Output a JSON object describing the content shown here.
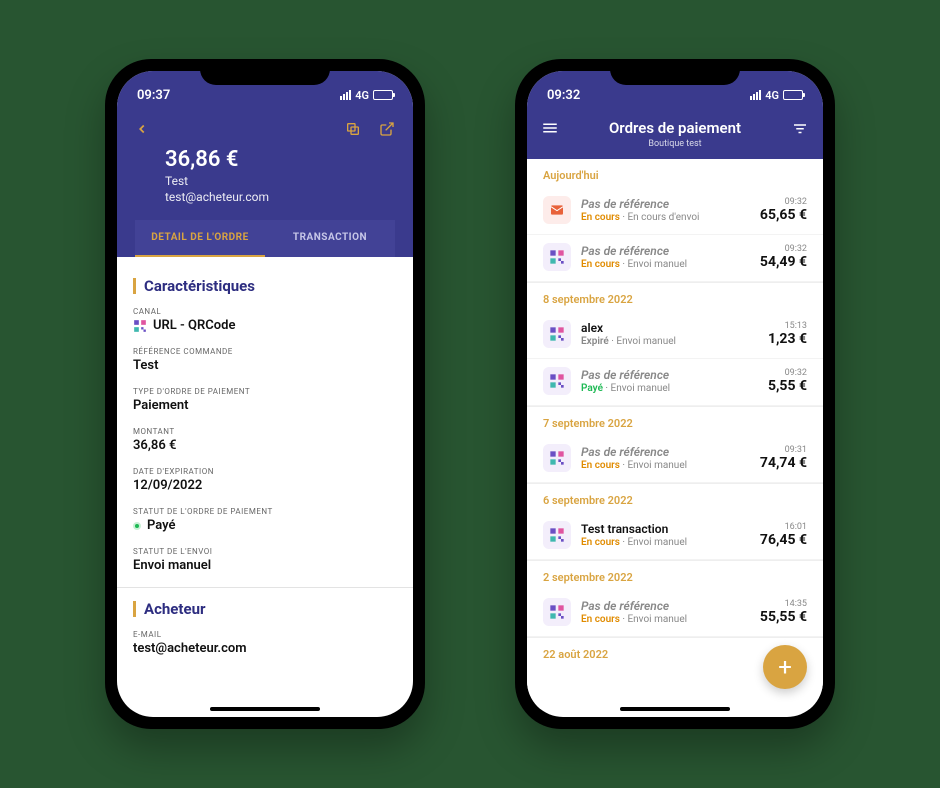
{
  "phone1": {
    "time": "09:37",
    "network": "4G",
    "header": {
      "amount": "36,86 €",
      "name": "Test",
      "email": "test@acheteur.com"
    },
    "tabs": {
      "detail": "DETAIL DE L'ORDRE",
      "transaction": "TRANSACTION"
    },
    "sections": {
      "caracteristiques": "Caractéristiques",
      "acheteur": "Acheteur"
    },
    "fields": {
      "canal": {
        "label": "CANAL",
        "value": "URL - QRCode"
      },
      "reference": {
        "label": "RÉFÉRENCE COMMANDE",
        "value": "Test"
      },
      "type": {
        "label": "TYPE D'ORDRE DE PAIEMENT",
        "value": "Paiement"
      },
      "montant": {
        "label": "MONTANT",
        "value": "36,86 €"
      },
      "expiration": {
        "label": "DATE D'EXPIRATION",
        "value": "12/09/2022"
      },
      "statut": {
        "label": "STATUT DE L'ORDRE DE PAIEMENT",
        "value": "Payé"
      },
      "envoi": {
        "label": "STATUT DE L'ENVOI",
        "value": "Envoi manuel"
      },
      "email": {
        "label": "E-MAIL",
        "value": "test@acheteur.com"
      }
    }
  },
  "phone2": {
    "time": "09:32",
    "network": "4G",
    "title": "Ordres de paiement",
    "subtitle": "Boutique test",
    "groups": [
      {
        "date": "Aujourd'hui",
        "orders": [
          {
            "icon": "mail",
            "ref": "Pas de référence",
            "noref": true,
            "status": "En cours",
            "statusClass": "en-cours",
            "method": "En cours d'envoi",
            "time": "09:32",
            "amount": "65,65 €"
          },
          {
            "icon": "qr",
            "ref": "Pas de référence",
            "noref": true,
            "status": "En cours",
            "statusClass": "en-cours",
            "method": "Envoi manuel",
            "time": "09:32",
            "amount": "54,49 €"
          }
        ]
      },
      {
        "date": "8 septembre 2022",
        "orders": [
          {
            "icon": "qr",
            "ref": "alex",
            "noref": false,
            "status": "Expiré",
            "statusClass": "expire",
            "method": "Envoi manuel",
            "time": "15:13",
            "amount": "1,23 €"
          },
          {
            "icon": "qr",
            "ref": "Pas de référence",
            "noref": true,
            "status": "Payé",
            "statusClass": "paye",
            "method": "Envoi manuel",
            "time": "09:32",
            "amount": "5,55 €"
          }
        ]
      },
      {
        "date": "7 septembre 2022",
        "orders": [
          {
            "icon": "qr",
            "ref": "Pas de référence",
            "noref": true,
            "status": "En cours",
            "statusClass": "en-cours",
            "method": "Envoi manuel",
            "time": "09:31",
            "amount": "74,74 €"
          }
        ]
      },
      {
        "date": "6 septembre 2022",
        "orders": [
          {
            "icon": "qr",
            "ref": "Test transaction",
            "noref": false,
            "status": "En cours",
            "statusClass": "en-cours",
            "method": "Envoi manuel",
            "time": "16:01",
            "amount": "76,45 €"
          }
        ]
      },
      {
        "date": "2 septembre 2022",
        "orders": [
          {
            "icon": "qr",
            "ref": "Pas de référence",
            "noref": true,
            "status": "En cours",
            "statusClass": "en-cours",
            "method": "Envoi manuel",
            "time": "14:35",
            "amount": "55,55 €"
          }
        ]
      },
      {
        "date": "22 août 2022",
        "orders": []
      }
    ]
  }
}
